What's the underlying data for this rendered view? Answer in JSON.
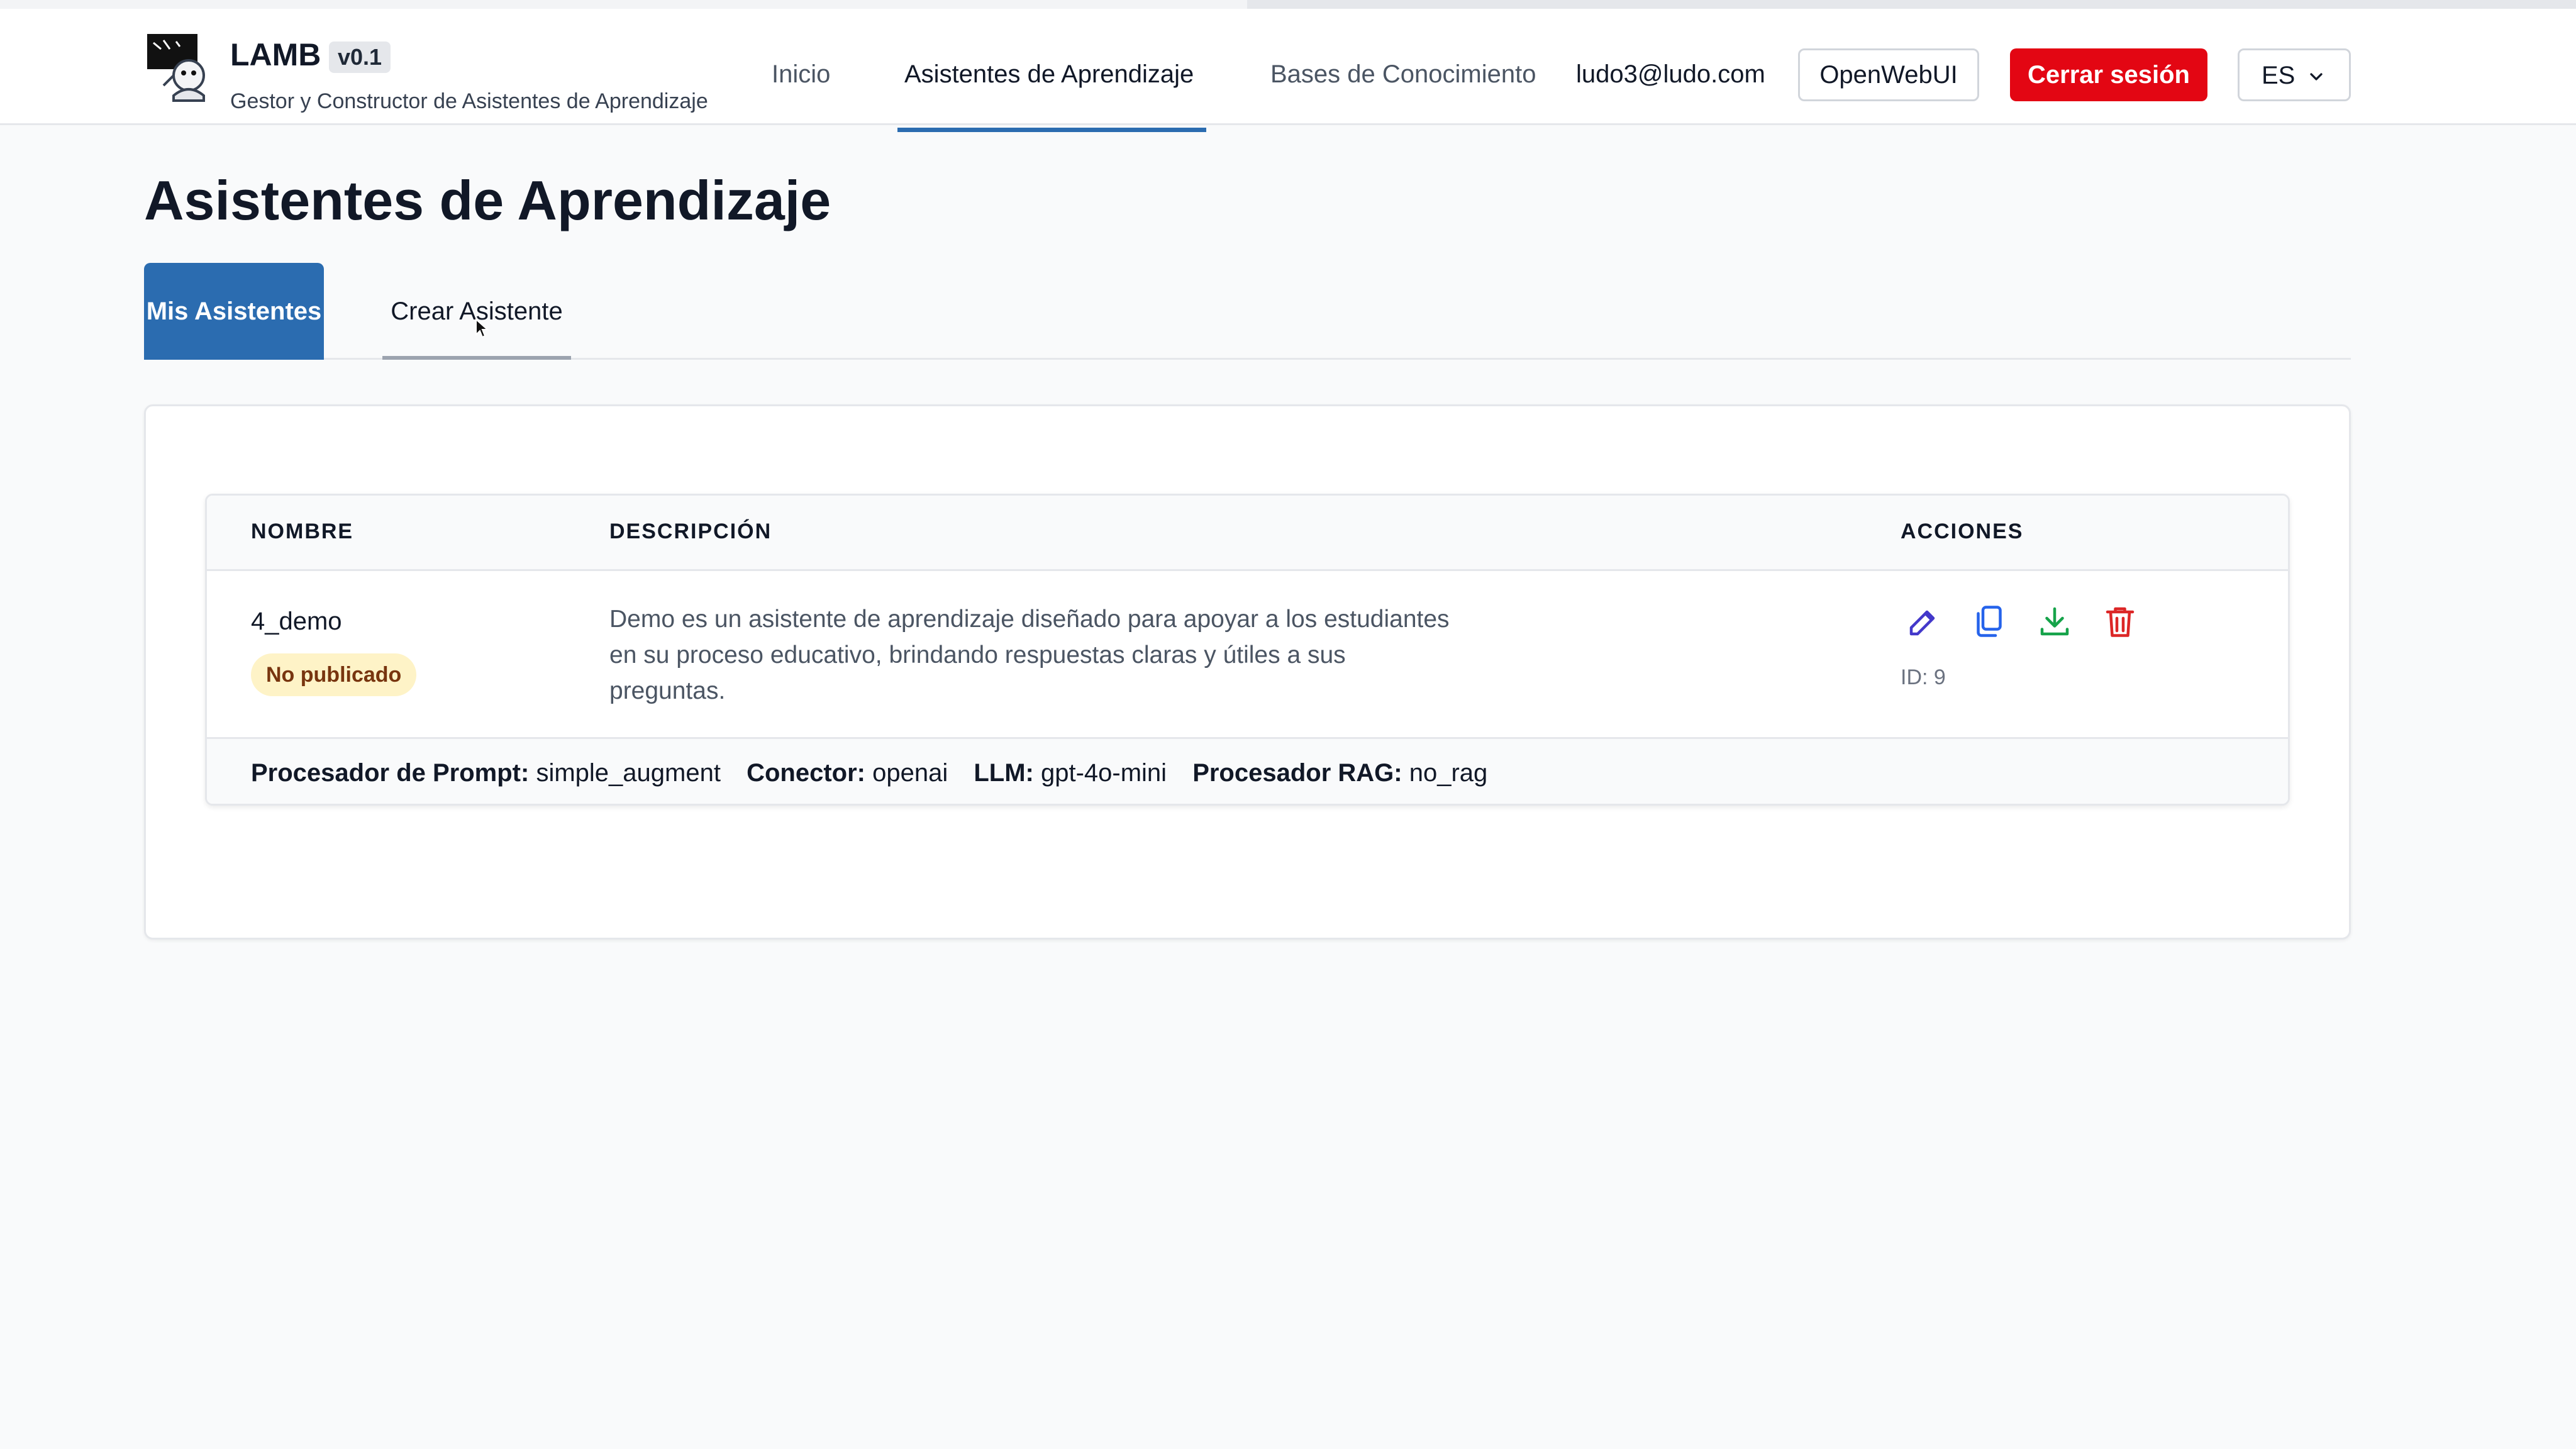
{
  "app": {
    "name": "LAMB",
    "version": "v0.1",
    "subtitle": "Gestor y Constructor de Asistentes de Aprendizaje"
  },
  "nav": {
    "items": [
      {
        "label": "Inicio",
        "active": false
      },
      {
        "label": "Asistentes de Aprendizaje",
        "active": true
      },
      {
        "label": "Bases de Conocimiento",
        "active": false
      }
    ],
    "user_email": "ludo3@ludo.com",
    "openwebui_label": "OpenWebUI",
    "logout_label": "Cerrar sesión",
    "language": "ES"
  },
  "page": {
    "title": "Asistentes de Aprendizaje",
    "tabs": [
      {
        "label": "Mis Asistentes",
        "active": true
      },
      {
        "label": "Crear Asistente",
        "active": false
      }
    ]
  },
  "table": {
    "headers": [
      "NOMBRE",
      "DESCRIPCIÓN",
      "ACCIONES"
    ],
    "rows": [
      {
        "name": "4_demo",
        "status": "No publicado",
        "description": "Demo es un asistente de aprendizaje diseñado para apoyar a los estudiantes en su proceso educativo, brindando respuestas claras y útiles a sus preguntas.",
        "id_label": "ID: 9",
        "actions": [
          {
            "icon": "edit-icon",
            "color": "#4338ca"
          },
          {
            "icon": "copy-icon",
            "color": "#2563eb"
          },
          {
            "icon": "download-icon",
            "color": "#16a34a"
          },
          {
            "icon": "trash-icon",
            "color": "#dc2626"
          }
        ],
        "details": {
          "prompt_processor_label": "Procesador de Prompt:",
          "prompt_processor": "simple_augment",
          "connector_label": "Conector:",
          "connector": "openai",
          "llm_label": "LLM:",
          "llm": "gpt-4o-mini",
          "rag_label": "Procesador RAG:",
          "rag": "no_rag"
        }
      }
    ]
  },
  "colors": {
    "primary": "#2b6cb0",
    "danger": "#e30613",
    "badge_bg": "#fef3c7",
    "badge_text": "#78350f"
  }
}
